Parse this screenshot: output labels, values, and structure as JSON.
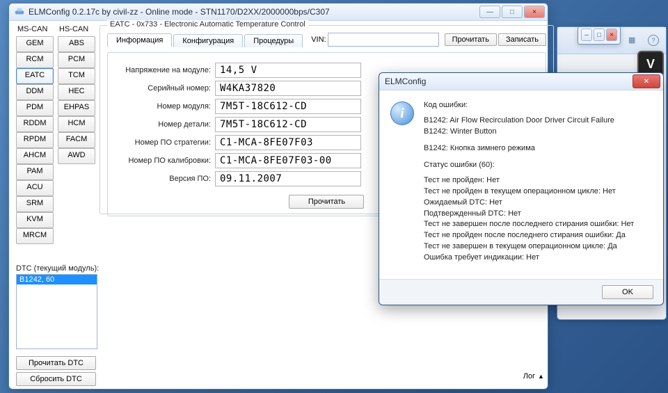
{
  "main": {
    "title": "ELMConfig 0.2.17c by civil-zz - Online mode - STN1170/D2XX/2000000bps/C307"
  },
  "bus": {
    "col1_header": "MS-CAN",
    "col2_header": "HS-CAN",
    "col1": [
      "GEM",
      "RCM",
      "EATC",
      "DDM",
      "PDM",
      "RDDM",
      "RPDM",
      "AHCM",
      "PAM",
      "ACU",
      "SRM",
      "KVM",
      "MRCM"
    ],
    "col2": [
      "ABS",
      "PCM",
      "TCM",
      "HEC",
      "EHPAS",
      "HCM",
      "FACM",
      "AWD"
    ],
    "selected": "EATC"
  },
  "dtc": {
    "label": "DTC (текущий модуль):",
    "items": [
      "B1242, 60"
    ],
    "selected_index": 0,
    "read_btn": "Прочитать DTC",
    "clear_btn": "Сбросить DTC"
  },
  "group": {
    "legend": "EATC - 0x733 - Electronic Automatic Temperature Control",
    "tabs": [
      "Информация",
      "Конфигурация",
      "Процедуры"
    ],
    "vin_label": "VIN:",
    "vin_value": "",
    "read_btn": "Прочитать",
    "write_btn": "Записать"
  },
  "info": {
    "rows": [
      {
        "label": "Напряжение на модуле:",
        "value": "14,5 V"
      },
      {
        "label": "Серийный номер:",
        "value": "W4KA37820"
      },
      {
        "label": "Номер модуля:",
        "value": "7M5T-18C612-CD"
      },
      {
        "label": "Номер детали:",
        "value": "7M5T-18C612-CD"
      },
      {
        "label": "Номер ПО стратегии:",
        "value": "C1-MCA-8FE07F03"
      },
      {
        "label": "Номер ПО калибровки:",
        "value": "C1-MCA-8FE07F03-00"
      },
      {
        "label": "Версия ПО:",
        "value": "09.11.2007"
      }
    ],
    "read_btn": "Прочитать"
  },
  "log_label": "Лог",
  "dialog": {
    "title": "ELMConfig",
    "header": "Код ошибки:",
    "lines1": [
      "B1242: Air Flow Recirculation Door Driver Circuit Failure",
      "B1242: Winter Button"
    ],
    "lines2": [
      "B1242: Кнопка зимнего режима"
    ],
    "status_header": "Статус ошибки (60):",
    "status_lines": [
      "Тест не пройден: Нет",
      "Тест не пройден в текущем операционном цикле: Нет",
      "Ожидаемый DTC: Нет",
      "Подтвержденный DTC: Нет",
      "Тест не завершен после последнего стирания ошибки: Нет",
      "Тест не пройден после последнего стирания ошибки: Да",
      "Тест не завершен в текущем операционном цикле: Да",
      "Ошибка требует индикации: Нет"
    ],
    "ok": "OK"
  }
}
